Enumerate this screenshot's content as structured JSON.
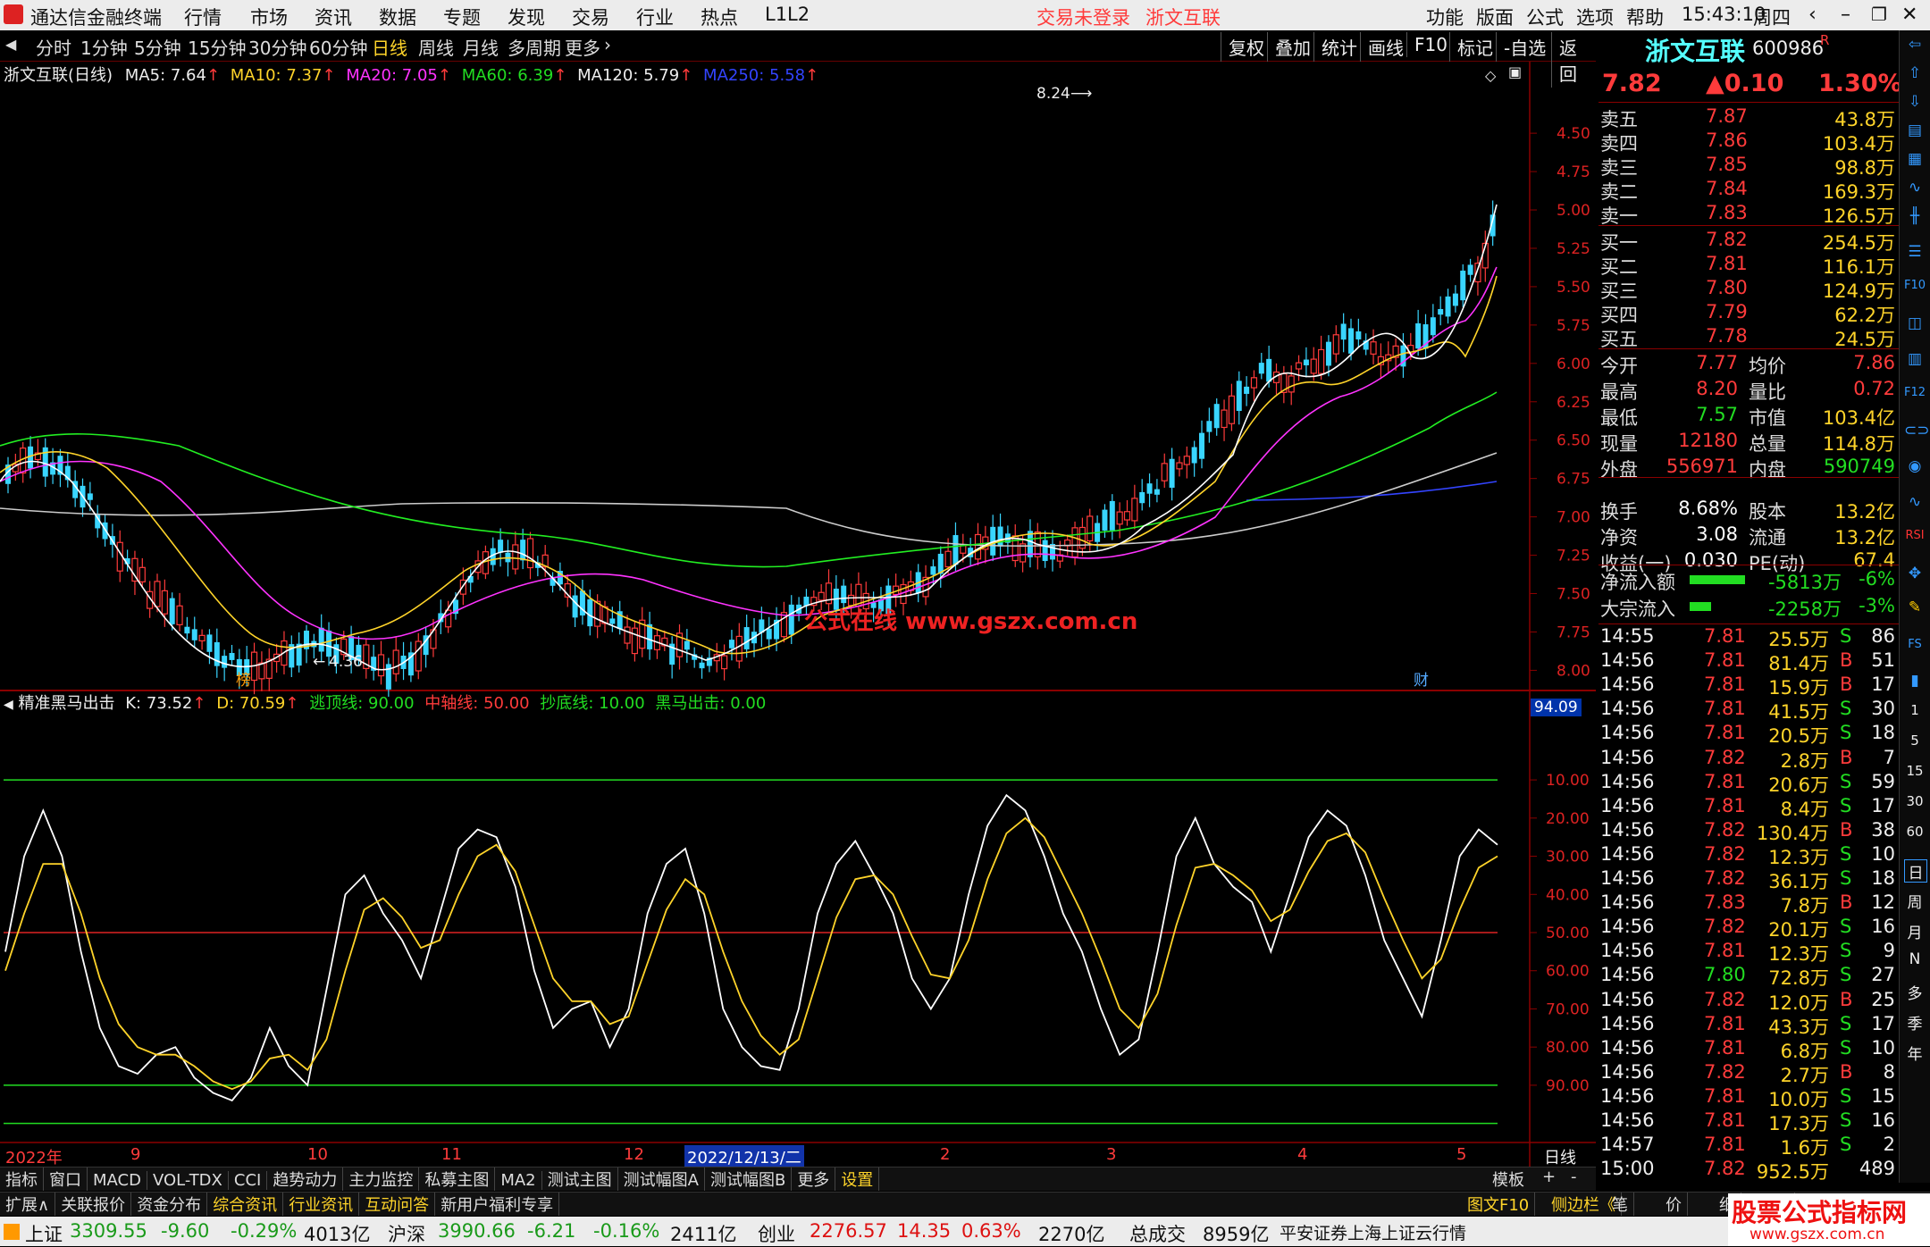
{
  "menubar": {
    "app_title": "通达信金融终端",
    "menus": [
      "行情",
      "市场",
      "资讯",
      "数据",
      "专题",
      "发现",
      "交易",
      "行业",
      "热点",
      "L1L2"
    ],
    "trade_status": "交易未登录",
    "stock_name": "浙文互联",
    "right_menus": [
      "功能",
      "版面",
      "公式",
      "选项",
      "帮助"
    ],
    "time": "15:43:10",
    "weekday": "周四"
  },
  "toolbar": {
    "periods": [
      "分时",
      "1分钟",
      "5分钟",
      "15分钟",
      "30分钟",
      "60分钟",
      "日线",
      "周线",
      "月线",
      "多周期",
      "更多"
    ],
    "active": "日线",
    "right_buttons": [
      "复权",
      "叠加",
      "统计",
      "画线",
      "F10",
      "标记",
      "-自选",
      "返回"
    ]
  },
  "main_chart": {
    "title": "浙文互联(日线)",
    "ma": [
      {
        "label": "MA5: 7.64",
        "color": "#ffffff"
      },
      {
        "label": "MA10: 7.37",
        "color": "#ffd42a"
      },
      {
        "label": "MA20: 7.05",
        "color": "#ff33ff"
      },
      {
        "label": "MA60: 6.39",
        "color": "#22ee22"
      },
      {
        "label": "MA120: 5.79",
        "color": "#ffffff"
      },
      {
        "label": "MA250: 5.58",
        "color": "#3344ff"
      }
    ],
    "high_label": "8.24",
    "low_label": "4.36",
    "bang_label": "榜",
    "cai_label": "财",
    "watermark": "公式在线  www.gszx.com.cn",
    "y_ticks": [
      "8.00",
      "7.75",
      "7.50",
      "7.25",
      "7.00",
      "6.75",
      "6.50",
      "6.25",
      "6.00",
      "5.75",
      "5.50",
      "5.25",
      "5.00",
      "4.75",
      "4.50"
    ]
  },
  "indicator": {
    "name": "精准黑马出击",
    "k": "K: 73.52",
    "d": "D: 70.59",
    "escape": "逃顶线: 90.00",
    "mid": "中轴线: 50.00",
    "bottom": "抄底线: 10.00",
    "hm": "黑马出击: 0.00",
    "current": "94.09",
    "y_ticks": [
      "90.00",
      "80.00",
      "70.00",
      "60.00",
      "50.00",
      "40.00",
      "30.00",
      "20.00",
      "10.00"
    ]
  },
  "xaxis": {
    "labels": [
      "2022年",
      "9",
      "10",
      "11",
      "12",
      "2022/12/13/二",
      "2",
      "3",
      "4",
      "5"
    ],
    "period": "日线"
  },
  "bottom_tabs": [
    "指标",
    "窗口",
    "MACD",
    "VOL-TDX",
    "CCI",
    "趋势动力",
    "主力监控",
    "私募主图",
    "MA2",
    "测试主图",
    "测试幅图A",
    "测试幅图B",
    "更多",
    "设置"
  ],
  "bottom_tabs_right": [
    "模板",
    "+",
    "-"
  ],
  "info_tabs": [
    "扩展∧",
    "关联报价",
    "资金分布",
    "综合资讯",
    "行业资讯",
    "互动问答",
    "新用户福利专享"
  ],
  "info_tabs_right": [
    "图文F10",
    "侧边栏《",
    "笔",
    "价",
    "细",
    "势"
  ],
  "quote": {
    "name": "浙文互联",
    "code": "600986",
    "price": "7.82",
    "change": "▲0.10",
    "pct": "1.30%",
    "asks": [
      {
        "label": "卖五",
        "price": "7.87",
        "vol": "43.8万"
      },
      {
        "label": "卖四",
        "price": "7.86",
        "vol": "103.4万"
      },
      {
        "label": "卖三",
        "price": "7.85",
        "vol": "98.8万"
      },
      {
        "label": "卖二",
        "price": "7.84",
        "vol": "169.3万"
      },
      {
        "label": "卖一",
        "price": "7.83",
        "vol": "126.5万"
      }
    ],
    "bids": [
      {
        "label": "买一",
        "price": "7.82",
        "vol": "254.5万"
      },
      {
        "label": "买二",
        "price": "7.81",
        "vol": "116.1万"
      },
      {
        "label": "买三",
        "price": "7.80",
        "vol": "124.9万"
      },
      {
        "label": "买四",
        "price": "7.79",
        "vol": "62.2万"
      },
      {
        "label": "买五",
        "price": "7.78",
        "vol": "24.5万"
      }
    ],
    "stats": [
      [
        "今开",
        "7.77",
        "均价",
        "7.86"
      ],
      [
        "最高",
        "8.20",
        "量比",
        "0.72"
      ],
      [
        "最低",
        "7.57",
        "市值",
        "103.4亿"
      ],
      [
        "现量",
        "12180",
        "总量",
        "114.8万"
      ],
      [
        "外盘",
        "556971",
        "内盘",
        "590749"
      ],
      [
        "换手",
        "8.68%",
        "股本",
        "13.2亿"
      ],
      [
        "净资",
        "3.08",
        "流通",
        "13.2亿"
      ],
      [
        "收益(一)",
        "0.030",
        "PE(动)",
        "67.4"
      ]
    ],
    "flows": [
      {
        "label": "净流入额",
        "value": "-5813万",
        "pct": "-6%"
      },
      {
        "label": "大宗流入",
        "value": "-2258万",
        "pct": "-3%"
      }
    ],
    "ticks": [
      [
        "14:55",
        "7.81",
        "25.5万",
        "S",
        "86"
      ],
      [
        "14:56",
        "7.81",
        "81.4万",
        "B",
        "51"
      ],
      [
        "14:56",
        "7.81",
        "15.9万",
        "B",
        "17"
      ],
      [
        "14:56",
        "7.81",
        "41.5万",
        "S",
        "30"
      ],
      [
        "14:56",
        "7.81",
        "20.5万",
        "S",
        "18"
      ],
      [
        "14:56",
        "7.82",
        "2.8万",
        "B",
        "7"
      ],
      [
        "14:56",
        "7.81",
        "20.6万",
        "S",
        "59"
      ],
      [
        "14:56",
        "7.81",
        "8.4万",
        "S",
        "17"
      ],
      [
        "14:56",
        "7.82",
        "130.4万",
        "B",
        "38"
      ],
      [
        "14:56",
        "7.82",
        "12.3万",
        "S",
        "10"
      ],
      [
        "14:56",
        "7.82",
        "36.1万",
        "S",
        "18"
      ],
      [
        "14:56",
        "7.83",
        "7.8万",
        "B",
        "12"
      ],
      [
        "14:56",
        "7.82",
        "20.1万",
        "S",
        "16"
      ],
      [
        "14:56",
        "7.81",
        "12.3万",
        "S",
        "9"
      ],
      [
        "14:56",
        "7.80",
        "72.8万",
        "S",
        "27"
      ],
      [
        "14:56",
        "7.82",
        "12.0万",
        "B",
        "25"
      ],
      [
        "14:56",
        "7.81",
        "43.3万",
        "S",
        "17"
      ],
      [
        "14:56",
        "7.81",
        "6.8万",
        "S",
        "10"
      ],
      [
        "14:56",
        "7.82",
        "2.7万",
        "B",
        "8"
      ],
      [
        "14:56",
        "7.81",
        "10.0万",
        "S",
        "15"
      ],
      [
        "14:56",
        "7.81",
        "17.3万",
        "S",
        "16"
      ],
      [
        "14:57",
        "7.81",
        "1.6万",
        "S",
        "2"
      ],
      [
        "15:00",
        "7.82",
        "952.5万",
        "",
        "489"
      ]
    ]
  },
  "right_sidebar_labels": [
    "日",
    "周",
    "月",
    "N",
    "多",
    "季",
    "年"
  ],
  "right_sidebar_nums": [
    "1",
    "5",
    "15",
    "30",
    "60"
  ],
  "statusbar": {
    "sh": {
      "name": "上证",
      "value": "3309.55",
      "chg": "-9.60",
      "pct": "-0.29%",
      "amt": "4013亿"
    },
    "sz": {
      "name": "沪深",
      "value": "3990.66",
      "chg": "-6.21",
      "pct": "-0.16%",
      "amt": "2411亿"
    },
    "cy": {
      "name": "创业",
      "value": "2276.57",
      "chg": "14.35",
      "pct": "0.63%",
      "amt": "2270亿"
    },
    "total_label": "总成交",
    "total": "8959亿",
    "server": "平安证券上海上证云行情",
    "brand": "股票公式指标网",
    "brand_url": "www.gszx.com.cn"
  },
  "chart_data": [
    {
      "type": "candlestick",
      "title": "浙文互联(日线)",
      "ylim": [
        4.45,
        8.35
      ],
      "y_ticks": [
        4.5,
        4.75,
        5.0,
        5.25,
        5.5,
        5.75,
        6.0,
        6.25,
        6.5,
        6.75,
        7.0,
        7.25,
        7.5,
        7.75,
        8.0
      ],
      "x_labels": [
        "2022年",
        "9",
        "10",
        "11",
        "12",
        "2022/12/13/二",
        "2",
        "3",
        "4",
        "5"
      ],
      "series": [
        {
          "name": "MA5"
        },
        {
          "name": "MA10"
        },
        {
          "name": "MA20"
        },
        {
          "name": "MA60"
        },
        {
          "name": "MA120"
        },
        {
          "name": "MA250"
        }
      ]
    },
    {
      "type": "line",
      "title": "精准黑马出击",
      "ylim": [
        0,
        100
      ],
      "y_ticks": [
        10,
        20,
        30,
        40,
        50,
        60,
        70,
        80,
        90
      ],
      "series": [
        {
          "name": "K",
          "values": [
            45,
            70,
            82,
            70,
            45,
            25,
            15,
            13,
            18,
            20,
            12,
            8,
            6,
            12,
            25,
            15,
            10,
            35,
            60,
            65,
            55,
            48,
            38,
            55,
            72,
            77,
            75,
            62,
            40,
            25,
            30,
            32,
            20,
            30,
            55,
            68,
            72,
            55,
            30,
            20,
            15,
            14,
            30,
            55,
            68,
            74,
            65,
            55,
            38,
            30,
            38,
            60,
            78,
            86,
            82,
            70,
            55,
            45,
            30,
            18,
            22,
            45,
            70,
            80,
            68,
            62,
            58,
            45,
            60,
            75,
            82,
            78,
            65,
            48,
            38,
            28,
            48,
            70,
            77,
            73
          ]
        },
        {
          "name": "D",
          "values": [
            40,
            55,
            68,
            68,
            55,
            38,
            26,
            20,
            18,
            18,
            15,
            11,
            9,
            11,
            17,
            18,
            14,
            22,
            40,
            56,
            59,
            54,
            46,
            48,
            60,
            70,
            73,
            66,
            52,
            38,
            32,
            32,
            26,
            28,
            42,
            56,
            64,
            60,
            45,
            32,
            23,
            18,
            22,
            38,
            54,
            64,
            65,
            60,
            49,
            39,
            38,
            48,
            64,
            76,
            80,
            75,
            65,
            55,
            43,
            30,
            25,
            34,
            52,
            67,
            68,
            65,
            61,
            53,
            56,
            66,
            74,
            76,
            71,
            59,
            48,
            38,
            43,
            56,
            67,
            70
          ]
        }
      ]
    }
  ]
}
